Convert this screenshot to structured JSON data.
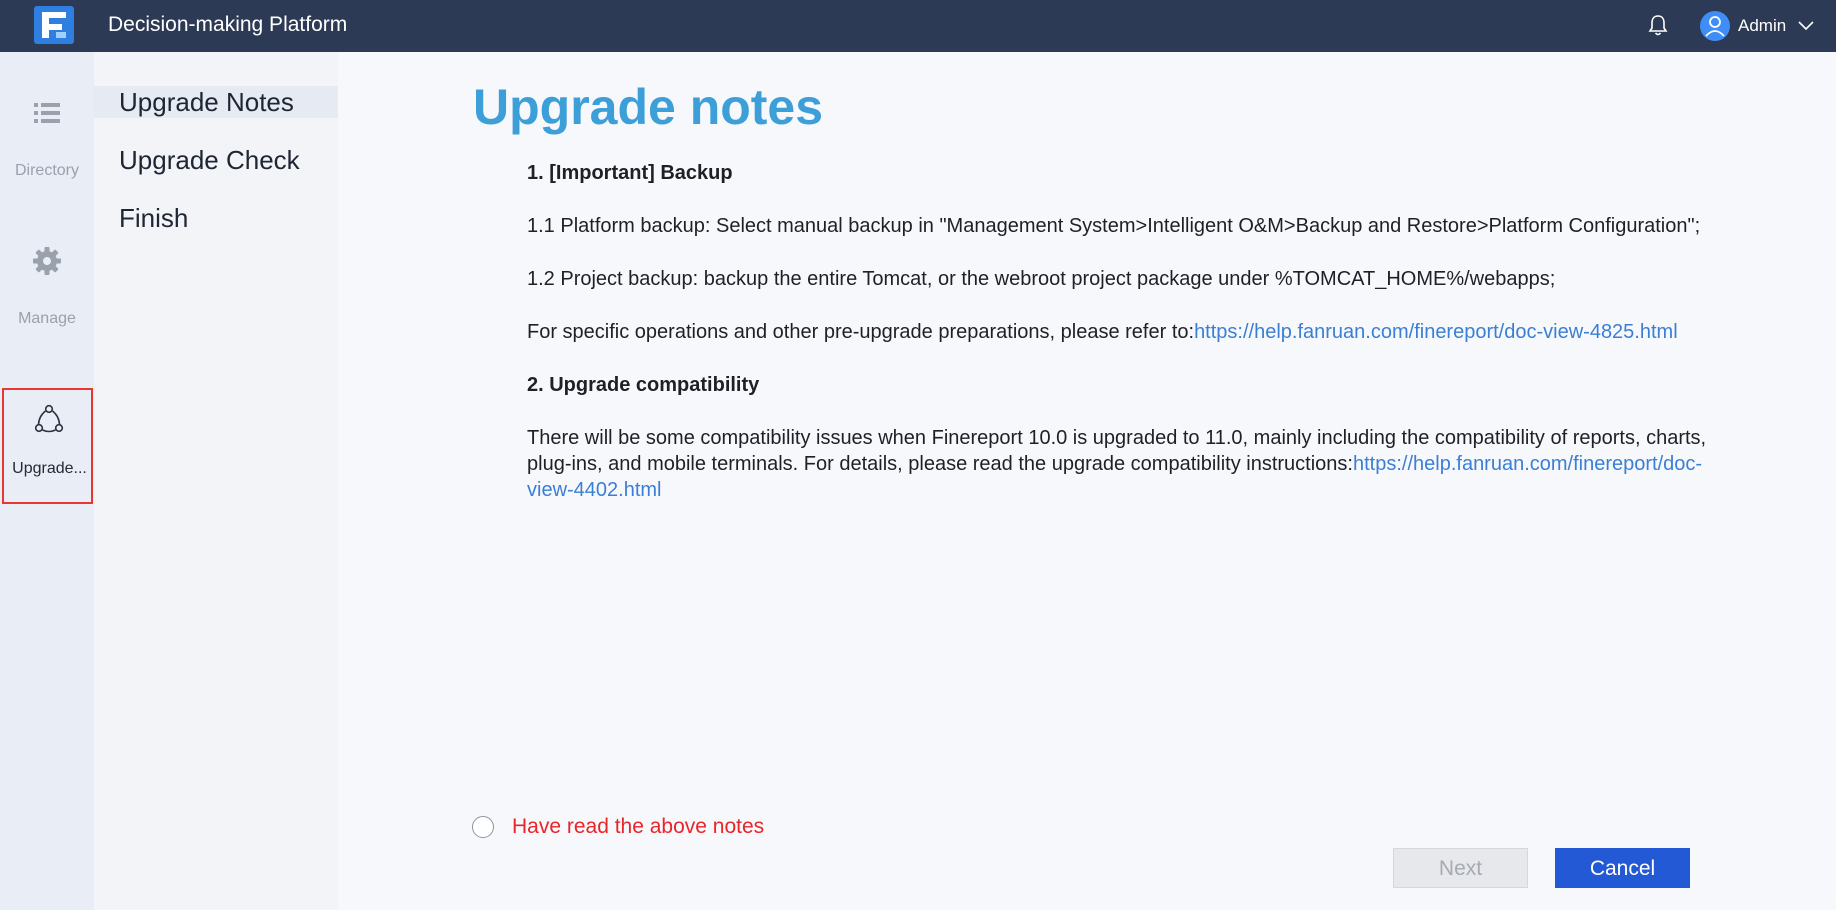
{
  "header": {
    "title": "Decision-making Platform",
    "user_name": "Admin"
  },
  "rail": {
    "directory_label": "Directory",
    "manage_label": "Manage",
    "upgrade_label": "Upgrade..."
  },
  "steps": [
    {
      "label": "Upgrade Notes",
      "active": true
    },
    {
      "label": "Upgrade Check",
      "active": false
    },
    {
      "label": "Finish",
      "active": false
    }
  ],
  "main": {
    "title": "Upgrade notes",
    "section1_heading": "1. [Important] Backup",
    "section1_p1": "1.1 Platform backup: Select manual backup in \"Management System>Intelligent O&M>Backup and Restore>Platform Configuration\";",
    "section1_p2": "1.2 Project backup: backup the entire Tomcat, or the webroot project package under %TOMCAT_HOME%/webapps;",
    "section1_p3_text": "For specific operations and other pre-upgrade preparations, please refer to:",
    "section1_p3_link": "https://help.fanruan.com/finereport/doc-view-4825.html",
    "section2_heading": "2. Upgrade compatibility",
    "section2_p1_text": "There will be some compatibility issues when Finereport 10.0 is upgraded to 11.0, mainly including the compatibility of reports, charts, plug-ins, and mobile terminals. For details, please read the upgrade compatibility instructions:",
    "section2_p1_link": "https://help.fanruan.com/finereport/doc-view-4402.html"
  },
  "footer": {
    "read_label": "Have read the above notes",
    "read_checked": false,
    "next_label": "Next",
    "cancel_label": "Cancel"
  },
  "colors": {
    "topbar": "#2c3a56",
    "title_blue": "#3d9fd8",
    "link": "#3a7fd5",
    "warning_red": "#e8262a",
    "primary_button": "#2459d6"
  }
}
